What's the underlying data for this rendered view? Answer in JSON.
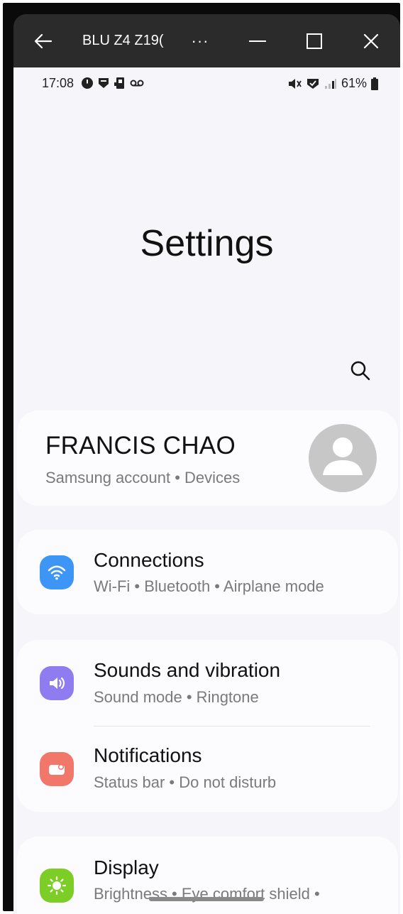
{
  "window": {
    "title": "BLU Z4 Z19(",
    "more_label": "···"
  },
  "statusbar": {
    "time": "17:08",
    "battery": "61%"
  },
  "page": {
    "title": "Settings"
  },
  "account": {
    "name": "FRANCIS CHAO",
    "subtitle": "Samsung account  •  Devices"
  },
  "items": [
    {
      "title": "Connections",
      "subtitle": "Wi-Fi  •  Bluetooth  •  Airplane mode",
      "icon": "wifi-icon",
      "color": "#3d95f5"
    },
    {
      "title": "Sounds and vibration",
      "subtitle": "Sound mode  •  Ringtone",
      "icon": "speaker-icon",
      "color": "#8f7cf0"
    },
    {
      "title": "Notifications",
      "subtitle": "Status bar  •  Do not disturb",
      "icon": "notification-icon",
      "color": "#f1776a"
    },
    {
      "title": "Display",
      "subtitle": "Brightness  •  Eye comfort shield  •",
      "icon": "sun-icon",
      "color": "#7ccd25"
    }
  ]
}
